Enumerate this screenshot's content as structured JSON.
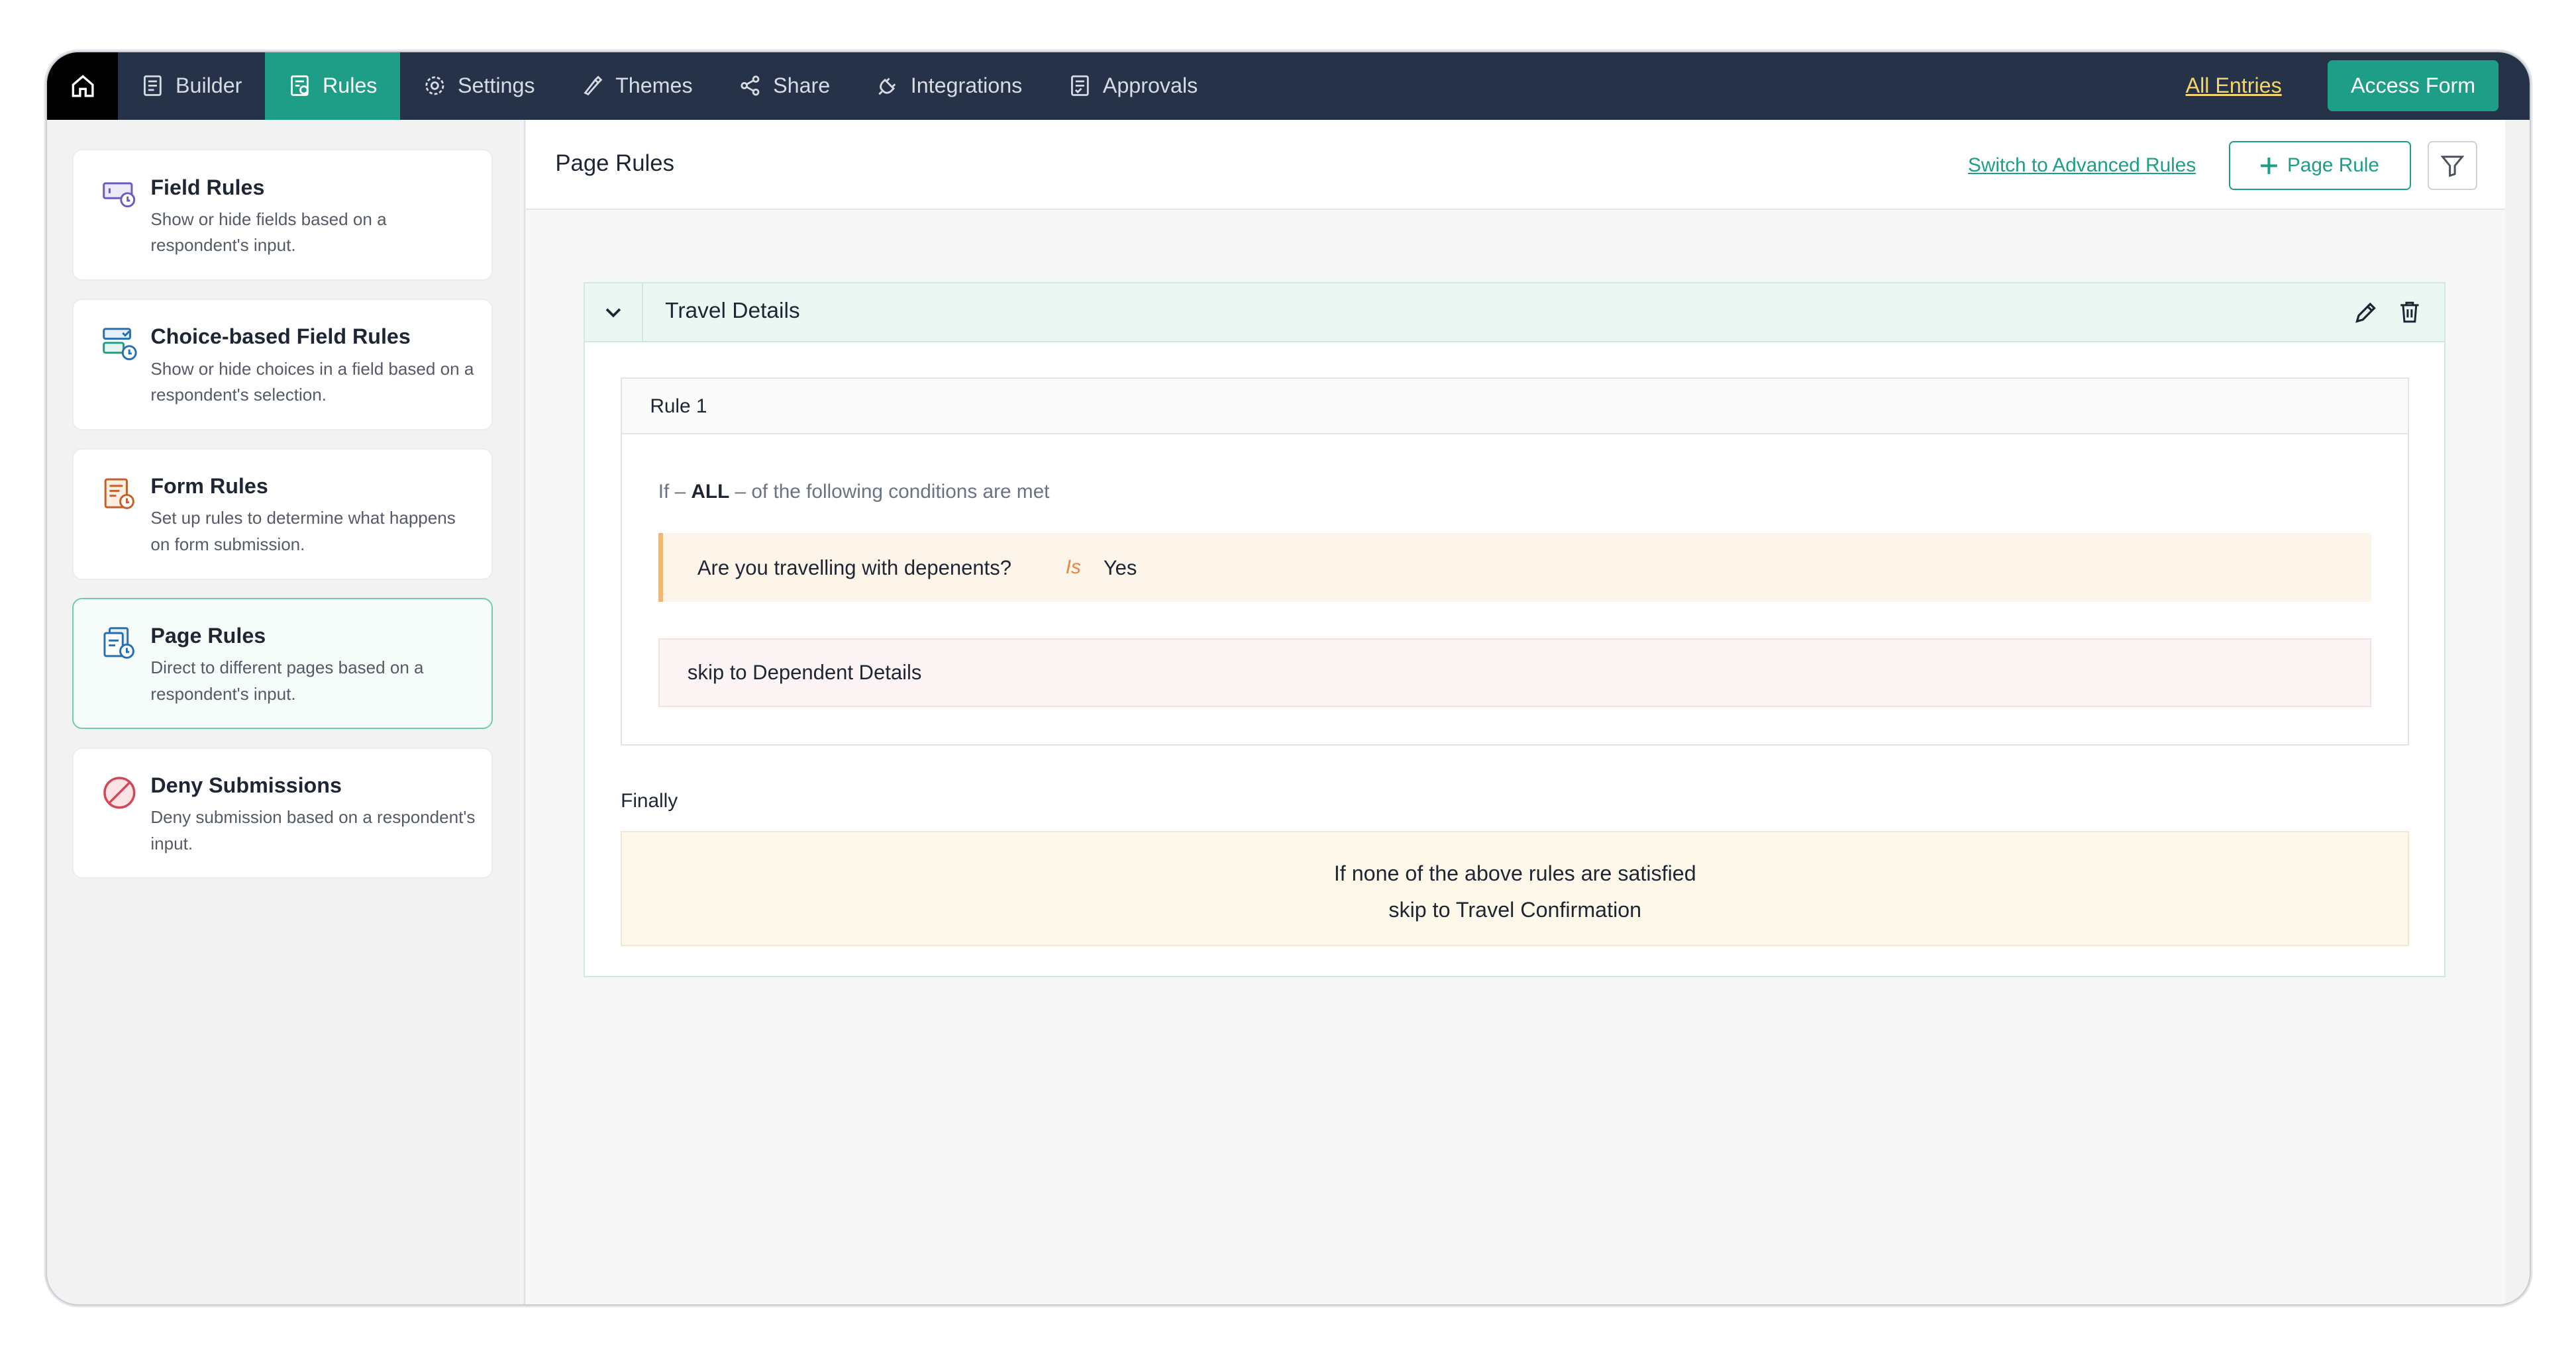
{
  "nav": {
    "tabs": [
      {
        "label": "Builder",
        "icon": "builder-icon"
      },
      {
        "label": "Rules",
        "icon": "rules-icon"
      },
      {
        "label": "Settings",
        "icon": "gear-icon"
      },
      {
        "label": "Themes",
        "icon": "brush-icon"
      },
      {
        "label": "Share",
        "icon": "share-icon"
      },
      {
        "label": "Integrations",
        "icon": "plug-icon"
      },
      {
        "label": "Approvals",
        "icon": "approvals-icon"
      }
    ],
    "active_tab": "Rules",
    "all_entries": "All Entries",
    "access_form": "Access Form"
  },
  "sidebar": {
    "items": [
      {
        "title": "Field Rules",
        "desc": "Show or hide fields based on a respondent's input.",
        "icon": "field-rules-icon"
      },
      {
        "title": "Choice-based Field Rules",
        "desc": "Show or hide choices in a field based on a respondent's selection.",
        "icon": "choice-rules-icon"
      },
      {
        "title": "Form Rules",
        "desc": "Set up rules to determine what happens on form submission.",
        "icon": "form-rules-icon"
      },
      {
        "title": "Page Rules",
        "desc": "Direct to different pages based on a respondent's input.",
        "icon": "page-rules-icon"
      },
      {
        "title": "Deny Submissions",
        "desc": "Deny submission based on a respondent's input.",
        "icon": "deny-icon"
      }
    ],
    "active_item": "Page Rules"
  },
  "main": {
    "title": "Page Rules",
    "switch_link": "Switch to Advanced Rules",
    "add_button": "Page Rule",
    "rule_group": {
      "name": "Travel Details",
      "rule": {
        "label": "Rule 1",
        "if": "If",
        "match": "ALL",
        "suffix": "of the following conditions are met",
        "condition": {
          "field": "Are you travelling with depenents?",
          "operator": "Is",
          "value": "Yes"
        },
        "action": "skip to Dependent Details"
      },
      "finally_label": "Finally",
      "finally_line1": "If none of the above rules are satisfied",
      "finally_line2": "skip to Travel Confirmation"
    }
  },
  "colors": {
    "nav_bg": "#263247",
    "accent": "#1f9e87",
    "all_entries": "#f5d46a",
    "operator": "#f0833a"
  }
}
